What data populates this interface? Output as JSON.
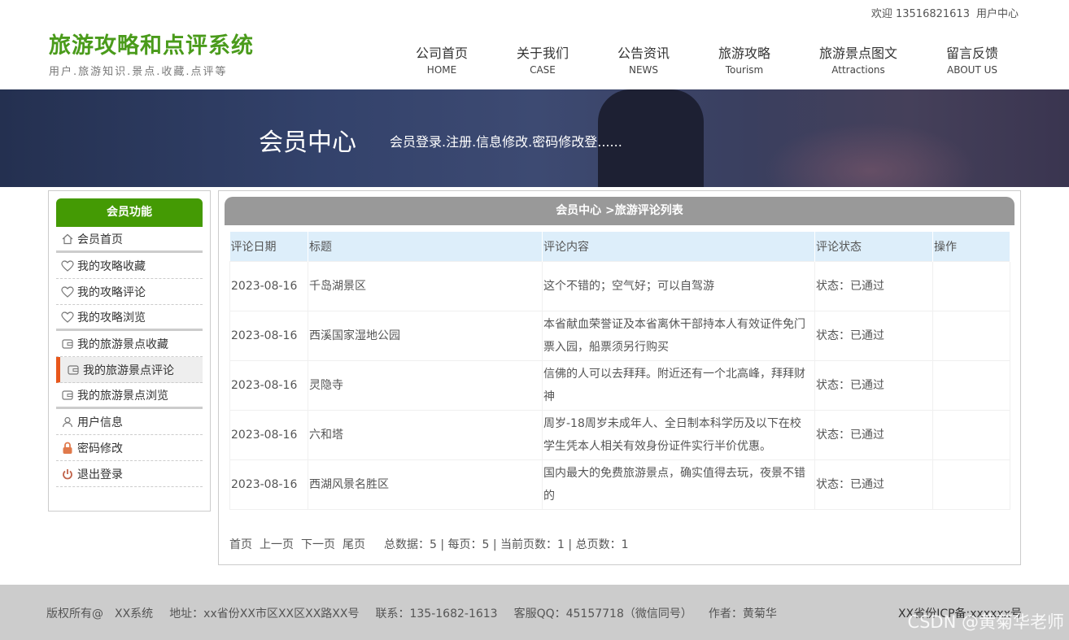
{
  "topbar": {
    "welcome": "欢迎 13516821613",
    "user_center": "用户中心"
  },
  "logo": {
    "title": "旅游攻略和点评系统",
    "subtitle": "用户.旅游知识.景点.收藏.点评等"
  },
  "nav": [
    {
      "cn": "公司首页",
      "en": "HOME"
    },
    {
      "cn": "关于我们",
      "en": "CASE"
    },
    {
      "cn": "公告资讯",
      "en": "NEWS"
    },
    {
      "cn": "旅游攻略",
      "en": "Tourism"
    },
    {
      "cn": "旅游景点图文",
      "en": "Attractions"
    },
    {
      "cn": "留言反馈",
      "en": "ABOUT US"
    }
  ],
  "banner": {
    "title": "会员中心",
    "desc": "会员登录.注册.信息修改.密码修改登......"
  },
  "sidebar": {
    "title": "会员功能",
    "items": [
      {
        "label": "会员首页",
        "icon": "home-icon"
      },
      {
        "label": "我的攻略收藏",
        "icon": "heart-icon"
      },
      {
        "label": "我的攻略评论",
        "icon": "heart-icon"
      },
      {
        "label": "我的攻略浏览",
        "icon": "heart-icon"
      },
      {
        "label": "我的旅游景点收藏",
        "icon": "wallet-icon"
      },
      {
        "label": "我的旅游景点评论",
        "icon": "wallet-icon"
      },
      {
        "label": "我的旅游景点浏览",
        "icon": "wallet-icon"
      },
      {
        "label": "用户信息",
        "icon": "user-icon"
      },
      {
        "label": "密码修改",
        "icon": "lock-icon"
      },
      {
        "label": "退出登录",
        "icon": "power-icon"
      }
    ]
  },
  "main": {
    "heading": "会员中心 >旅游评论列表",
    "columns": [
      "评论日期",
      "标题",
      "评论内容",
      "评论状态",
      "操作"
    ],
    "rows": [
      {
        "date": "2023-08-16",
        "title": "千岛湖景区",
        "content": "这个不错的；空气好；可以自驾游",
        "status": "状态：已通过",
        "op": ""
      },
      {
        "date": "2023-08-16",
        "title": "西溪国家湿地公园",
        "content": "本省献血荣誉证及本省离休干部持本人有效证件免门票入园，船票须另行购买",
        "status": "状态：已通过",
        "op": ""
      },
      {
        "date": "2023-08-16",
        "title": "灵隐寺",
        "content": "信佛的人可以去拜拜。附近还有一个北高峰，拜拜财神",
        "status": "状态：已通过",
        "op": ""
      },
      {
        "date": "2023-08-16",
        "title": "六和塔",
        "content": "周岁-18周岁未成年人、全日制本科学历及以下在校学生凭本人相关有效身份证件实行半价优惠。",
        "status": "状态：已通过",
        "op": ""
      },
      {
        "date": "2023-08-16",
        "title": "西湖风景名胜区",
        "content": "国内最大的免费旅游景点，确实值得去玩，夜景不错的",
        "status": "状态：已通过",
        "op": ""
      }
    ],
    "pager": {
      "first": "首页",
      "prev": "上一页",
      "next": "下一页",
      "last": "尾页",
      "stats": "总数据：5 | 每页：5 | 当前页数：1 | 总页数：1"
    }
  },
  "footer": {
    "copyright": "版权所有@　XX系统",
    "address": "地址：xx省份XX市区XX区XX路XX号",
    "contact": "联系：135-1682-1613",
    "qq": "客服QQ：45157718（微信同号）",
    "author": "作者：黄菊华",
    "icp": "XX省份ICP备:xxxxxx号",
    "watermark": "CSDN @黄菊华老师"
  },
  "colors": {
    "brand_green": "#449a04",
    "title_green": "#4a9b1b",
    "active_marker": "#e8571b",
    "table_header": "#ddeefa"
  }
}
